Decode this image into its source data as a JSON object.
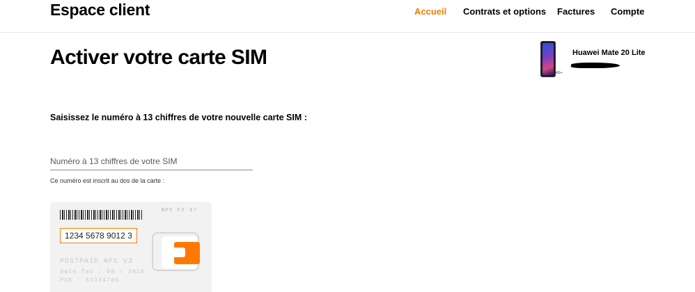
{
  "header": {
    "brand": "Espace client",
    "nav": [
      {
        "label": "Accueil",
        "active": true
      },
      {
        "label": "Contrats et options",
        "active": false
      },
      {
        "label": "Factures",
        "active": false
      },
      {
        "label": "Compte",
        "active": false
      }
    ]
  },
  "page": {
    "title": "Activer votre carte SIM"
  },
  "device": {
    "name": "Huawei Mate 20 Lite",
    "badge": "4G+",
    "icon": "smartphone-icon"
  },
  "form": {
    "instruction": "Saisissez le numéro à 13 chiffres de votre nouvelle carte SIM :",
    "sim_input": {
      "value": "",
      "placeholder": "Numéro à 13 chiffres de votre SIM"
    },
    "hint": "Ce numéro est inscrit au dos de la carte :"
  },
  "sim_card": {
    "nfc_code": "NFC F2 37",
    "example_number": "1234 5678 9012 3",
    "line1": "POSTPAID NFC V3",
    "line2": "date fab : 08 / 2018",
    "line3": "PUK : 53324786"
  },
  "colors": {
    "accent": "#ff7900",
    "text": "#000000",
    "divider": "#e6e6e6"
  }
}
